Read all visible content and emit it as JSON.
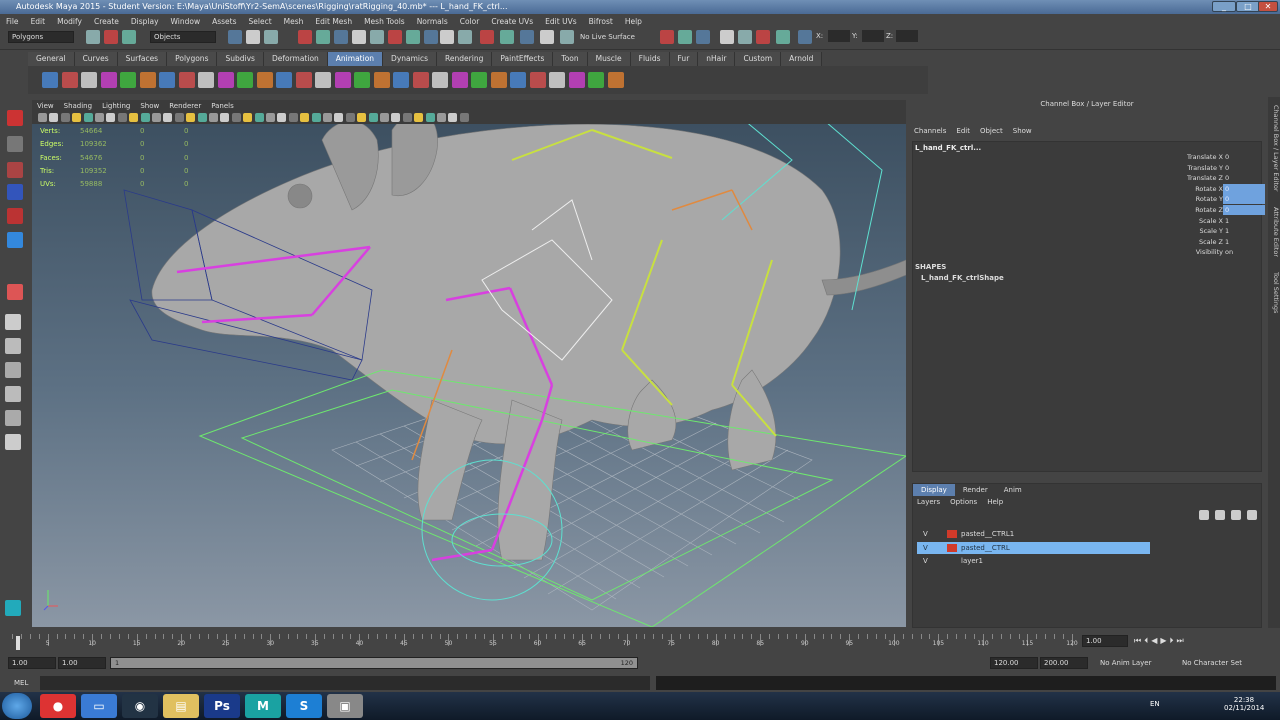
{
  "window": {
    "title": "Autodesk Maya 2015 - Student Version: E:\\Maya\\UniStoff\\Yr2-SemA\\scenes\\Rigging\\ratRigging_40.mb*   ---   L_hand_FK_ctrl..."
  },
  "menubar": [
    "File",
    "Edit",
    "Modify",
    "Create",
    "Display",
    "Window",
    "Assets",
    "Select",
    "Mesh",
    "Edit Mesh",
    "Mesh Tools",
    "Normals",
    "Color",
    "Create UVs",
    "Edit UVs",
    "Bifrost",
    "Help"
  ],
  "statusline": {
    "mode": "Polygons",
    "objects_label": "Objects",
    "live_surface": "No Live Surface",
    "x_label": "X:",
    "y_label": "Y:",
    "z_label": "Z:"
  },
  "shelf_tabs": [
    "General",
    "Curves",
    "Surfaces",
    "Polygons",
    "Subdivs",
    "Deformation",
    "Animation",
    "Dynamics",
    "Rendering",
    "PaintEffects",
    "Toon",
    "Muscle",
    "Fluids",
    "Fur",
    "nHair",
    "Custom",
    "Arnold"
  ],
  "active_shelf_tab": "Animation",
  "viewport": {
    "menu": [
      "View",
      "Shading",
      "Lighting",
      "Show",
      "Renderer",
      "Panels"
    ],
    "hud": [
      {
        "label": "Verts:",
        "v1": "54664",
        "v2": "0",
        "v3": "0"
      },
      {
        "label": "Edges:",
        "v1": "109362",
        "v2": "0",
        "v3": "0"
      },
      {
        "label": "Faces:",
        "v1": "54676",
        "v2": "0",
        "v3": "0"
      },
      {
        "label": "Tris:",
        "v1": "109352",
        "v2": "0",
        "v3": "0"
      },
      {
        "label": "UVs:",
        "v1": "59888",
        "v2": "0",
        "v3": "0"
      }
    ]
  },
  "channel_box": {
    "header": "Channel Box / Layer Editor",
    "menu": [
      "Channels",
      "Edit",
      "Object",
      "Show"
    ],
    "object_name": "L_hand_FK_ctrl...",
    "channels": [
      {
        "name": "Translate X",
        "value": "0",
        "selected": false
      },
      {
        "name": "Translate Y",
        "value": "0",
        "selected": false
      },
      {
        "name": "Translate Z",
        "value": "0",
        "selected": false
      },
      {
        "name": "Rotate X",
        "value": "0",
        "selected": true
      },
      {
        "name": "Rotate Y",
        "value": "0",
        "selected": true
      },
      {
        "name": "Rotate Z",
        "value": "0",
        "selected": true
      },
      {
        "name": "Scale X",
        "value": "1",
        "selected": false
      },
      {
        "name": "Scale Y",
        "value": "1",
        "selected": false
      },
      {
        "name": "Scale Z",
        "value": "1",
        "selected": false
      },
      {
        "name": "Visibility",
        "value": "on",
        "selected": false
      }
    ],
    "shapes_label": "SHAPES",
    "shape_name": "L_hand_FK_ctrlShape"
  },
  "layer_editor": {
    "tabs": [
      "Display",
      "Render",
      "Anim"
    ],
    "menu": [
      "Layers",
      "Options",
      "Help"
    ],
    "layers": [
      {
        "vis": "V",
        "name": "pasted__CTRL1",
        "color": "#d03a2a",
        "selected": false
      },
      {
        "vis": "V",
        "name": "pasted__CTRL",
        "color": "#d03a2a",
        "selected": true
      },
      {
        "vis": "V",
        "name": "layer1",
        "color": "",
        "selected": false
      }
    ]
  },
  "side_tabs": [
    "Channel Box / Layer Editor",
    "Attribute Editor",
    "Tool Settings"
  ],
  "time_slider": {
    "ticks": [
      "5",
      "10",
      "15",
      "20",
      "25",
      "30",
      "35",
      "40",
      "45",
      "50",
      "55",
      "60",
      "65",
      "70",
      "75",
      "80",
      "85",
      "90",
      "95",
      "100",
      "105",
      "110",
      "115",
      "120"
    ],
    "current": "1.00"
  },
  "range_slider": {
    "start": "1.00",
    "range_start": "1.00",
    "range_start_handle": "1",
    "range_end_handle": "120",
    "range_end": "120.00",
    "end": "200.00",
    "anim_layer": "No Anim Layer",
    "character_set": "No Character Set"
  },
  "command_line": {
    "label": "MEL"
  },
  "taskbar": {
    "lang": "EN",
    "time": "22:38",
    "date": "02/11/2014",
    "apps": [
      "chrome-icon",
      "explorer-icon",
      "steam-icon",
      "folder-icon",
      "photoshop-icon",
      "maya-icon",
      "skype-icon",
      "app-icon"
    ]
  },
  "colors": {
    "accent": "#5c7fae",
    "selection": "#6fa2de",
    "layer_selected": "#79b6f0"
  }
}
